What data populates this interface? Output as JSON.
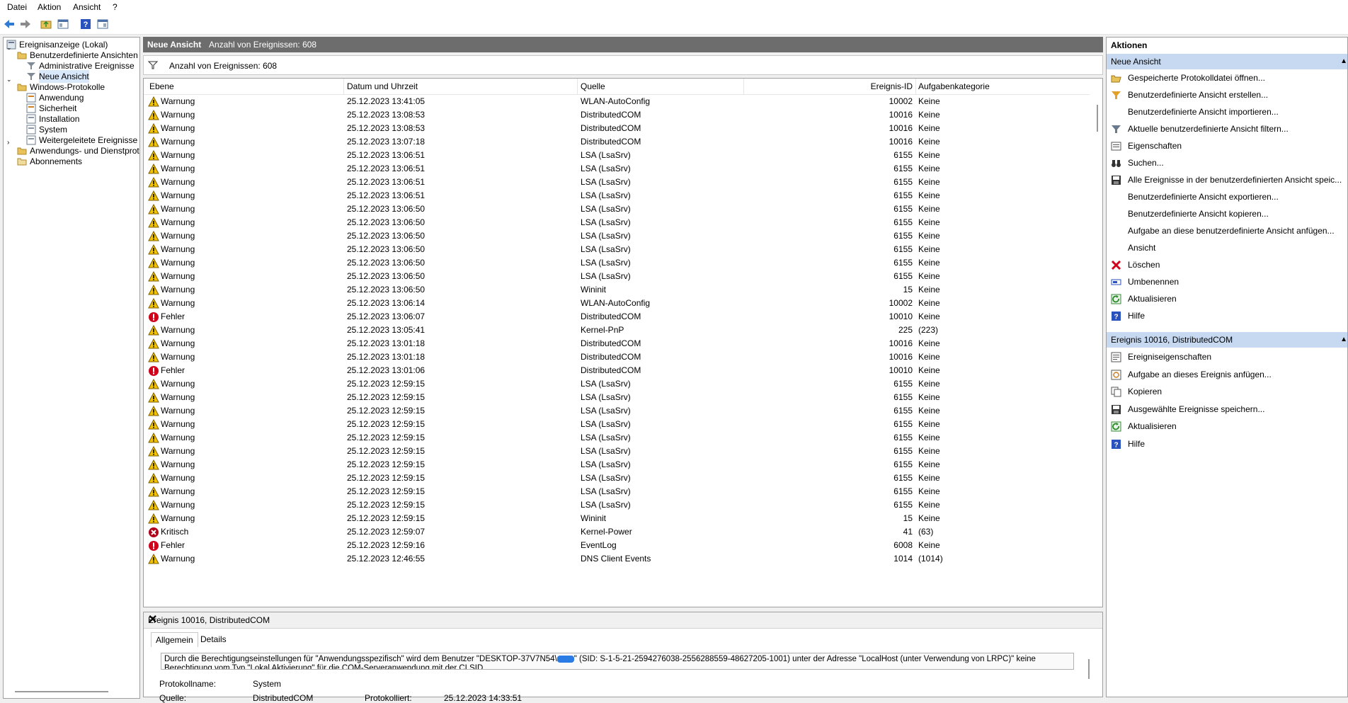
{
  "menu": [
    "Datei",
    "Aktion",
    "Ansicht",
    "?"
  ],
  "toolbar_icons": [
    "back-icon",
    "forward-icon",
    "folder-up-icon",
    "show-hide-tree-icon",
    "help-icon",
    "show-action-pane-icon"
  ],
  "tree": {
    "root": "Ereignisanzeige (Lokal)",
    "custom_views": "Benutzerdefinierte Ansichten",
    "admin_events": "Administrative Ereignisse",
    "new_view": "Neue Ansicht",
    "windows_logs": "Windows-Protokolle",
    "application": "Anwendung",
    "security": "Sicherheit",
    "setup": "Installation",
    "system": "System",
    "forwarded": "Weitergeleitete Ereignisse",
    "app_services": "Anwendungs- und Dienstprotokolle",
    "subscriptions": "Abonnements"
  },
  "center": {
    "title": "Neue Ansicht",
    "count": "Anzahl von Ereignissen: 608",
    "filter_text": "Anzahl von Ereignissen: 608",
    "columns": [
      "Ebene",
      "Datum und Uhrzeit",
      "Quelle",
      "Ereignis-ID",
      "Aufgabenkategorie"
    ]
  },
  "events": [
    {
      "level": "Warnung",
      "type": "warning",
      "date": "25.12.2023 13:41:05",
      "source": "WLAN-AutoConfig",
      "id": "10002",
      "cat": "Keine"
    },
    {
      "level": "Warnung",
      "type": "warning",
      "date": "25.12.2023 13:08:53",
      "source": "DistributedCOM",
      "id": "10016",
      "cat": "Keine"
    },
    {
      "level": "Warnung",
      "type": "warning",
      "date": "25.12.2023 13:08:53",
      "source": "DistributedCOM",
      "id": "10016",
      "cat": "Keine"
    },
    {
      "level": "Warnung",
      "type": "warning",
      "date": "25.12.2023 13:07:18",
      "source": "DistributedCOM",
      "id": "10016",
      "cat": "Keine"
    },
    {
      "level": "Warnung",
      "type": "warning",
      "date": "25.12.2023 13:06:51",
      "source": "LSA (LsaSrv)",
      "id": "6155",
      "cat": "Keine"
    },
    {
      "level": "Warnung",
      "type": "warning",
      "date": "25.12.2023 13:06:51",
      "source": "LSA (LsaSrv)",
      "id": "6155",
      "cat": "Keine"
    },
    {
      "level": "Warnung",
      "type": "warning",
      "date": "25.12.2023 13:06:51",
      "source": "LSA (LsaSrv)",
      "id": "6155",
      "cat": "Keine"
    },
    {
      "level": "Warnung",
      "type": "warning",
      "date": "25.12.2023 13:06:51",
      "source": "LSA (LsaSrv)",
      "id": "6155",
      "cat": "Keine"
    },
    {
      "level": "Warnung",
      "type": "warning",
      "date": "25.12.2023 13:06:50",
      "source": "LSA (LsaSrv)",
      "id": "6155",
      "cat": "Keine"
    },
    {
      "level": "Warnung",
      "type": "warning",
      "date": "25.12.2023 13:06:50",
      "source": "LSA (LsaSrv)",
      "id": "6155",
      "cat": "Keine"
    },
    {
      "level": "Warnung",
      "type": "warning",
      "date": "25.12.2023 13:06:50",
      "source": "LSA (LsaSrv)",
      "id": "6155",
      "cat": "Keine"
    },
    {
      "level": "Warnung",
      "type": "warning",
      "date": "25.12.2023 13:06:50",
      "source": "LSA (LsaSrv)",
      "id": "6155",
      "cat": "Keine"
    },
    {
      "level": "Warnung",
      "type": "warning",
      "date": "25.12.2023 13:06:50",
      "source": "LSA (LsaSrv)",
      "id": "6155",
      "cat": "Keine"
    },
    {
      "level": "Warnung",
      "type": "warning",
      "date": "25.12.2023 13:06:50",
      "source": "LSA (LsaSrv)",
      "id": "6155",
      "cat": "Keine"
    },
    {
      "level": "Warnung",
      "type": "warning",
      "date": "25.12.2023 13:06:50",
      "source": "Wininit",
      "id": "15",
      "cat": "Keine"
    },
    {
      "level": "Warnung",
      "type": "warning",
      "date": "25.12.2023 13:06:14",
      "source": "WLAN-AutoConfig",
      "id": "10002",
      "cat": "Keine"
    },
    {
      "level": "Fehler",
      "type": "error",
      "date": "25.12.2023 13:06:07",
      "source": "DistributedCOM",
      "id": "10010",
      "cat": "Keine"
    },
    {
      "level": "Warnung",
      "type": "warning",
      "date": "25.12.2023 13:05:41",
      "source": "Kernel-PnP",
      "id": "225",
      "cat": "(223)"
    },
    {
      "level": "Warnung",
      "type": "warning",
      "date": "25.12.2023 13:01:18",
      "source": "DistributedCOM",
      "id": "10016",
      "cat": "Keine"
    },
    {
      "level": "Warnung",
      "type": "warning",
      "date": "25.12.2023 13:01:18",
      "source": "DistributedCOM",
      "id": "10016",
      "cat": "Keine"
    },
    {
      "level": "Fehler",
      "type": "error",
      "date": "25.12.2023 13:01:06",
      "source": "DistributedCOM",
      "id": "10010",
      "cat": "Keine"
    },
    {
      "level": "Warnung",
      "type": "warning",
      "date": "25.12.2023 12:59:15",
      "source": "LSA (LsaSrv)",
      "id": "6155",
      "cat": "Keine"
    },
    {
      "level": "Warnung",
      "type": "warning",
      "date": "25.12.2023 12:59:15",
      "source": "LSA (LsaSrv)",
      "id": "6155",
      "cat": "Keine"
    },
    {
      "level": "Warnung",
      "type": "warning",
      "date": "25.12.2023 12:59:15",
      "source": "LSA (LsaSrv)",
      "id": "6155",
      "cat": "Keine"
    },
    {
      "level": "Warnung",
      "type": "warning",
      "date": "25.12.2023 12:59:15",
      "source": "LSA (LsaSrv)",
      "id": "6155",
      "cat": "Keine"
    },
    {
      "level": "Warnung",
      "type": "warning",
      "date": "25.12.2023 12:59:15",
      "source": "LSA (LsaSrv)",
      "id": "6155",
      "cat": "Keine"
    },
    {
      "level": "Warnung",
      "type": "warning",
      "date": "25.12.2023 12:59:15",
      "source": "LSA (LsaSrv)",
      "id": "6155",
      "cat": "Keine"
    },
    {
      "level": "Warnung",
      "type": "warning",
      "date": "25.12.2023 12:59:15",
      "source": "LSA (LsaSrv)",
      "id": "6155",
      "cat": "Keine"
    },
    {
      "level": "Warnung",
      "type": "warning",
      "date": "25.12.2023 12:59:15",
      "source": "LSA (LsaSrv)",
      "id": "6155",
      "cat": "Keine"
    },
    {
      "level": "Warnung",
      "type": "warning",
      "date": "25.12.2023 12:59:15",
      "source": "LSA (LsaSrv)",
      "id": "6155",
      "cat": "Keine"
    },
    {
      "level": "Warnung",
      "type": "warning",
      "date": "25.12.2023 12:59:15",
      "source": "LSA (LsaSrv)",
      "id": "6155",
      "cat": "Keine"
    },
    {
      "level": "Warnung",
      "type": "warning",
      "date": "25.12.2023 12:59:15",
      "source": "Wininit",
      "id": "15",
      "cat": "Keine"
    },
    {
      "level": "Kritisch",
      "type": "critical",
      "date": "25.12.2023 12:59:07",
      "source": "Kernel-Power",
      "id": "41",
      "cat": "(63)"
    },
    {
      "level": "Fehler",
      "type": "error",
      "date": "25.12.2023 12:59:16",
      "source": "EventLog",
      "id": "6008",
      "cat": "Keine"
    },
    {
      "level": "Warnung",
      "type": "warning",
      "date": "25.12.2023 12:46:55",
      "source": "DNS Client Events",
      "id": "1014",
      "cat": "(1014)"
    }
  ],
  "detail": {
    "title": "Ereignis 10016, DistributedCOM",
    "tab_general": "Allgemein",
    "tab_details": "Details",
    "message_line1_pre": "Durch die Berechtigungseinstellungen für \"Anwendungsspezifisch\" wird dem Benutzer \"DESKTOP-37V7N54\\",
    "message_line1_post": "\" (SID: S-1-5-21-2594276038-2556288559-48627205-1001) unter der Adresse \"LocalHost (unter Verwendung von LRPC)\" keine",
    "message_line2": "Berechtigung vom Typ \"Lokal Aktivierung\" für die COM-Serveranwendung mit der CLSID",
    "log_name_label": "Protokollname:",
    "log_name_value": "System",
    "source_label": "Quelle:",
    "source_value": "DistributedCOM",
    "logged_label": "Protokolliert:",
    "logged_value": "25.12.2023 14:33:51"
  },
  "actions": {
    "title": "Aktionen",
    "section1": "Neue Ansicht",
    "items1": [
      {
        "label": "Gespeicherte Protokolldatei öffnen...",
        "icon": "open-folder-icon"
      },
      {
        "label": "Benutzerdefinierte Ansicht erstellen...",
        "icon": "filter-create-icon"
      },
      {
        "label": "Benutzerdefinierte Ansicht importieren...",
        "icon": ""
      },
      {
        "label": "Aktuelle benutzerdefinierte Ansicht filtern...",
        "icon": "filter-icon"
      },
      {
        "label": "Eigenschaften",
        "icon": "properties-icon"
      },
      {
        "label": "Suchen...",
        "icon": "binoculars-icon"
      },
      {
        "label": "Alle Ereignisse in der benutzerdefinierten Ansicht speic...",
        "icon": "save-icon"
      },
      {
        "label": "Benutzerdefinierte Ansicht exportieren...",
        "icon": ""
      },
      {
        "label": "Benutzerdefinierte Ansicht kopieren...",
        "icon": ""
      },
      {
        "label": "Aufgabe an diese benutzerdefinierte Ansicht anfügen...",
        "icon": ""
      },
      {
        "label": "Ansicht",
        "icon": ""
      },
      {
        "label": "Löschen",
        "icon": "delete-icon"
      },
      {
        "label": "Umbenennen",
        "icon": "rename-icon"
      },
      {
        "label": "Aktualisieren",
        "icon": "refresh-icon"
      },
      {
        "label": "Hilfe",
        "icon": "help-icon"
      }
    ],
    "section2": "Ereignis 10016, DistributedCOM",
    "items2": [
      {
        "label": "Ereigniseigenschaften",
        "icon": "event-properties-icon"
      },
      {
        "label": "Aufgabe an dieses Ereignis anfügen...",
        "icon": "task-icon"
      },
      {
        "label": "Kopieren",
        "icon": "copy-icon"
      },
      {
        "label": "Ausgewählte Ereignisse speichern...",
        "icon": "save-icon"
      },
      {
        "label": "Aktualisieren",
        "icon": "refresh-icon"
      },
      {
        "label": "Hilfe",
        "icon": "help-icon"
      }
    ]
  },
  "colors": {
    "selection": "#d9e8fb",
    "section": "#c6d9f1",
    "header": "#6d6d6d",
    "warning": "#f5c400",
    "error": "#d0021b"
  }
}
